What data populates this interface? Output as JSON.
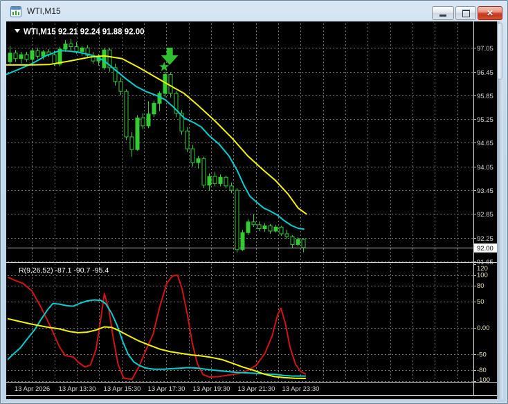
{
  "window": {
    "title": "WTI,M15",
    "controls": {
      "minimize": "minimize",
      "restore": "restore",
      "close": "close"
    }
  },
  "chart": {
    "header": {
      "expander": "▼",
      "text": "WTI,M15  92.21 92.24 91.88 92.00",
      "symbol": "WTI,M15",
      "open": "92.21",
      "high": "92.24",
      "low": "91.88",
      "close": "92.00"
    },
    "price_axis": {
      "ticks": [
        "97.05",
        "96.45",
        "95.85",
        "95.25",
        "94.65",
        "94.05",
        "93.45",
        "92.85",
        "92.25",
        "91.65"
      ],
      "current": "92.00"
    },
    "time_axis": {
      "labels": [
        "13 Apr 2026",
        "13 Apr 13:30",
        "13 Apr 15:30",
        "13 Apr 17:30",
        "13 Apr 19:30",
        "13 Apr 21:30",
        "13 Apr 23:30"
      ]
    }
  },
  "indicator_pane": {
    "label": "R(9,26,52) -87.1 -90.7 -95.4",
    "name": "R(9,26,52)",
    "values": [
      "-87.1",
      "-90.7",
      "-95.4"
    ],
    "axis_ticks": [
      "120",
      "100",
      "80",
      "50",
      "0.00",
      "-50",
      "-80",
      "-100"
    ]
  },
  "colors": {
    "background": "#000000",
    "grid": "#7a7a7a",
    "bull_candle": "#33cc33",
    "bear_candle_fill": "#000000",
    "candle_outline": "#33cc33",
    "ma_fast": "#00cfcf",
    "ma_slow": "#f5f500",
    "indicator_fast": "#d11414",
    "indicator_mid": "#00cfcf",
    "indicator_slow": "#f5f500",
    "signal_marker": "#2fbf2f",
    "current_price_line": "#c8c8c8",
    "axis_text": "#dcdcdc",
    "indicator_axis_text": "#eae5c0"
  },
  "chart_data": {
    "type": "candlestick",
    "symbol": "WTI",
    "timeframe": "M15",
    "title": "WTI,M15",
    "ylim": [
      91.65,
      97.35
    ],
    "price_ticks": [
      97.05,
      96.45,
      95.85,
      95.25,
      94.65,
      94.05,
      93.45,
      92.85,
      92.25,
      91.65
    ],
    "current_price": 92.0,
    "candles": [
      [
        96.7,
        97.1,
        96.62,
        96.92
      ],
      [
        96.92,
        97.0,
        96.7,
        96.78
      ],
      [
        96.78,
        96.95,
        96.65,
        96.88
      ],
      [
        96.88,
        96.95,
        96.7,
        96.76
      ],
      [
        96.76,
        97.05,
        96.7,
        96.98
      ],
      [
        96.98,
        97.05,
        96.78,
        96.84
      ],
      [
        96.84,
        97.0,
        96.76,
        96.95
      ],
      [
        96.95,
        97.02,
        96.82,
        96.88
      ],
      [
        96.88,
        96.98,
        96.6,
        96.64
      ],
      [
        96.64,
        97.08,
        96.58,
        97.02
      ],
      [
        97.02,
        97.25,
        96.95,
        97.15
      ],
      [
        97.15,
        97.28,
        97.0,
        97.08
      ],
      [
        97.08,
        97.2,
        96.9,
        96.96
      ],
      [
        96.96,
        97.1,
        96.85,
        97.05
      ],
      [
        97.05,
        97.12,
        96.8,
        96.86
      ],
      [
        96.86,
        96.95,
        96.65,
        96.72
      ],
      [
        96.72,
        96.9,
        96.6,
        96.85
      ],
      [
        96.55,
        97.05,
        96.5,
        97.0
      ],
      [
        97.0,
        97.05,
        96.45,
        96.55
      ],
      [
        96.55,
        96.65,
        96.1,
        96.2
      ],
      [
        96.2,
        96.3,
        95.85,
        95.95
      ],
      [
        95.95,
        96.0,
        94.72,
        94.8
      ],
      [
        94.8,
        94.92,
        94.3,
        94.48
      ],
      [
        94.48,
        95.35,
        94.45,
        95.28
      ],
      [
        95.28,
        95.4,
        95.0,
        95.08
      ],
      [
        95.08,
        95.7,
        95.02,
        95.38
      ],
      [
        95.38,
        95.72,
        95.3,
        95.65
      ],
      [
        95.65,
        95.95,
        95.45,
        95.9
      ],
      [
        95.9,
        96.45,
        95.8,
        96.38
      ],
      [
        96.38,
        96.42,
        95.8,
        95.9
      ],
      [
        95.9,
        95.95,
        95.3,
        95.4
      ],
      [
        95.4,
        95.48,
        94.85,
        94.95
      ],
      [
        94.95,
        95.05,
        94.42,
        94.5
      ],
      [
        94.5,
        94.6,
        94.05,
        94.15
      ],
      [
        94.15,
        94.32,
        94.0,
        94.25
      ],
      [
        94.25,
        94.3,
        93.5,
        93.58
      ],
      [
        93.58,
        93.88,
        93.45,
        93.8
      ],
      [
        93.8,
        93.92,
        93.55,
        93.62
      ],
      [
        93.62,
        93.85,
        93.55,
        93.78
      ],
      [
        93.78,
        93.82,
        93.5,
        93.56
      ],
      [
        93.56,
        93.65,
        93.38,
        93.45
      ],
      [
        93.45,
        93.5,
        91.88,
        91.95
      ],
      [
        91.95,
        92.45,
        91.92,
        92.38
      ],
      [
        92.38,
        92.72,
        92.32,
        92.65
      ],
      [
        92.65,
        92.85,
        92.52,
        92.58
      ],
      [
        92.58,
        92.66,
        92.42,
        92.48
      ],
      [
        92.48,
        92.62,
        92.4,
        92.55
      ],
      [
        92.55,
        92.6,
        92.35,
        92.42
      ],
      [
        92.42,
        92.58,
        92.38,
        92.52
      ],
      [
        92.52,
        92.55,
        92.3,
        92.35
      ],
      [
        92.35,
        92.45,
        92.22,
        92.28
      ],
      [
        92.28,
        92.32,
        92.0,
        92.08
      ],
      [
        92.08,
        92.26,
        92.03,
        92.21
      ],
      [
        92.21,
        92.24,
        91.88,
        92.0
      ]
    ],
    "overlays": [
      {
        "name": "ma-fast",
        "color": "#00cfcf",
        "points": [
          [
            -0.6,
            96.38
          ],
          [
            1.5,
            96.5
          ],
          [
            4.0,
            96.65
          ],
          [
            6.5,
            96.85
          ],
          [
            9.0,
            96.98
          ],
          [
            10.9,
            96.97
          ],
          [
            12.8,
            96.93
          ],
          [
            15.3,
            96.85
          ],
          [
            17.1,
            96.72
          ],
          [
            19.0,
            96.5
          ],
          [
            20.9,
            96.28
          ],
          [
            22.8,
            96.08
          ],
          [
            24.6,
            95.95
          ],
          [
            26.5,
            95.85
          ],
          [
            28.1,
            95.74
          ],
          [
            29.6,
            95.55
          ],
          [
            31.5,
            95.28
          ],
          [
            33.4,
            95.15
          ],
          [
            34.6,
            95.05
          ],
          [
            35.9,
            94.85
          ],
          [
            37.8,
            94.62
          ],
          [
            39.6,
            94.32
          ],
          [
            41.1,
            93.95
          ],
          [
            42.4,
            93.55
          ],
          [
            43.4,
            93.3
          ],
          [
            44.6,
            93.15
          ],
          [
            45.9,
            93.0
          ],
          [
            47.1,
            92.92
          ],
          [
            48.4,
            92.82
          ],
          [
            49.6,
            92.68
          ],
          [
            50.9,
            92.56
          ],
          [
            52.1,
            92.49
          ],
          [
            53.1,
            92.47
          ]
        ]
      },
      {
        "name": "ma-slow",
        "color": "#f5f500",
        "points": [
          [
            -0.6,
            96.62
          ],
          [
            3.4,
            96.62
          ],
          [
            7.1,
            96.63
          ],
          [
            10.9,
            96.72
          ],
          [
            14.6,
            96.82
          ],
          [
            17.1,
            96.85
          ],
          [
            20.3,
            96.78
          ],
          [
            23.4,
            96.55
          ],
          [
            27.1,
            96.25
          ],
          [
            29.6,
            96.05
          ],
          [
            31.5,
            95.9
          ],
          [
            34.0,
            95.6
          ],
          [
            37.1,
            95.2
          ],
          [
            40.3,
            94.75
          ],
          [
            43.0,
            94.32
          ],
          [
            45.9,
            93.95
          ],
          [
            48.0,
            93.7
          ],
          [
            50.3,
            93.35
          ],
          [
            52.1,
            93.0
          ],
          [
            53.6,
            92.85
          ]
        ]
      }
    ],
    "markers": [
      {
        "type": "arrow-down",
        "color": "#2fbf2f",
        "candle": 28.9,
        "price": 96.62
      },
      {
        "type": "star",
        "color": "#2fbf2f",
        "candle": 27.9,
        "price": 96.57
      }
    ],
    "subchart": {
      "label": "R(9,26,52)",
      "current_values": [
        -87.1,
        -90.7,
        -95.4
      ],
      "ylim": [
        -112,
        124
      ],
      "axis_ticks": [
        120,
        100,
        80,
        50,
        0,
        -50,
        -80,
        -100
      ],
      "levels": [
        100,
        80,
        50,
        0,
        -50,
        -80,
        -100
      ],
      "series": [
        {
          "name": "R-fast",
          "color": "#d11414",
          "points": [
            [
              -0.6,
              97
            ],
            [
              0.9,
              90
            ],
            [
              2.4,
              84
            ],
            [
              4.0,
              70
            ],
            [
              5.6,
              40
            ],
            [
              7.3,
              4
            ],
            [
              9.0,
              -36
            ],
            [
              10.0,
              -52
            ],
            [
              11.5,
              -55
            ],
            [
              12.5,
              -66
            ],
            [
              13.6,
              -74
            ],
            [
              14.6,
              -70
            ],
            [
              15.6,
              -40
            ],
            [
              16.5,
              20
            ],
            [
              17.1,
              65
            ],
            [
              17.9,
              35
            ],
            [
              18.8,
              -25
            ],
            [
              19.6,
              -70
            ],
            [
              20.6,
              -95
            ],
            [
              22.1,
              -97
            ],
            [
              23.4,
              -72
            ],
            [
              24.6,
              -42
            ],
            [
              25.9,
              -12
            ],
            [
              27.1,
              40
            ],
            [
              28.4,
              85
            ],
            [
              29.4,
              98
            ],
            [
              30.3,
              100
            ],
            [
              31.1,
              75
            ],
            [
              32.1,
              25
            ],
            [
              33.0,
              -30
            ],
            [
              33.9,
              -68
            ],
            [
              34.9,
              -88
            ],
            [
              36.1,
              -93
            ],
            [
              37.8,
              -92
            ],
            [
              39.6,
              -89
            ],
            [
              41.5,
              -86
            ],
            [
              43.1,
              -80
            ],
            [
              44.6,
              -70
            ],
            [
              46.1,
              -48
            ],
            [
              47.4,
              -15
            ],
            [
              48.4,
              25
            ],
            [
              49.0,
              37
            ],
            [
              49.8,
              8
            ],
            [
              50.6,
              -35
            ],
            [
              51.6,
              -68
            ],
            [
              52.5,
              -82
            ],
            [
              53.4,
              -87
            ]
          ]
        },
        {
          "name": "R-mid",
          "color": "#00cfcf",
          "points": [
            [
              -0.6,
              -62
            ],
            [
              0.6,
              -50
            ],
            [
              1.9,
              -38
            ],
            [
              3.1,
              -22
            ],
            [
              4.4,
              -5
            ],
            [
              5.6,
              15
            ],
            [
              6.9,
              35
            ],
            [
              7.8,
              46
            ],
            [
              9.0,
              45
            ],
            [
              10.3,
              42
            ],
            [
              11.5,
              41
            ],
            [
              12.8,
              47
            ],
            [
              14.0,
              51
            ],
            [
              15.3,
              53
            ],
            [
              16.5,
              52
            ],
            [
              17.4,
              45
            ],
            [
              18.4,
              28
            ],
            [
              19.4,
              5
            ],
            [
              20.4,
              -25
            ],
            [
              21.4,
              -50
            ],
            [
              22.4,
              -64
            ],
            [
              23.4,
              -71
            ],
            [
              24.6,
              -76
            ],
            [
              26.1,
              -78
            ],
            [
              27.8,
              -78
            ],
            [
              29.4,
              -77
            ],
            [
              30.9,
              -76
            ],
            [
              32.4,
              -75
            ],
            [
              33.9,
              -76
            ],
            [
              35.4,
              -78
            ],
            [
              37.1,
              -80
            ],
            [
              39.0,
              -82
            ],
            [
              40.9,
              -84
            ],
            [
              42.8,
              -85
            ],
            [
              44.6,
              -86
            ],
            [
              46.5,
              -87
            ],
            [
              48.1,
              -88
            ],
            [
              49.6,
              -90
            ],
            [
              51.1,
              -91
            ],
            [
              53.4,
              -91
            ]
          ]
        },
        {
          "name": "R-slow",
          "color": "#f5f500",
          "points": [
            [
              -0.6,
              18
            ],
            [
              1.5,
              13
            ],
            [
              4.0,
              7
            ],
            [
              6.5,
              2
            ],
            [
              9.0,
              -2
            ],
            [
              10.9,
              -7
            ],
            [
              12.4,
              -9
            ],
            [
              14.0,
              -8
            ],
            [
              15.6,
              -4
            ],
            [
              17.1,
              2
            ],
            [
              18.4,
              1
            ],
            [
              19.9,
              -6
            ],
            [
              21.5,
              -15
            ],
            [
              23.4,
              -25
            ],
            [
              25.3,
              -33
            ],
            [
              27.1,
              -40
            ],
            [
              29.0,
              -45
            ],
            [
              30.9,
              -48
            ],
            [
              32.8,
              -51
            ],
            [
              34.6,
              -53
            ],
            [
              36.5,
              -56
            ],
            [
              38.4,
              -60
            ],
            [
              40.3,
              -67
            ],
            [
              42.1,
              -74
            ],
            [
              44.0,
              -80
            ],
            [
              45.9,
              -87
            ],
            [
              47.8,
              -92
            ],
            [
              49.6,
              -94
            ],
            [
              51.5,
              -95
            ],
            [
              53.4,
              -95.4
            ]
          ]
        }
      ]
    }
  }
}
